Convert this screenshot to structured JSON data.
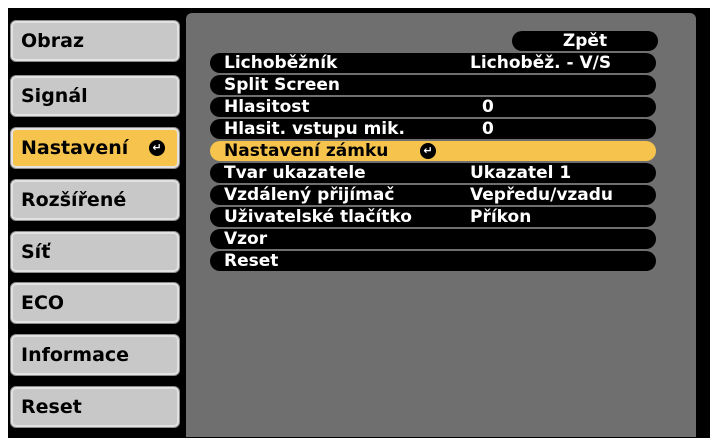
{
  "sidebar": {
    "items": [
      {
        "label": "Obraz"
      },
      {
        "label": "Signál"
      },
      {
        "label": "Nastavení"
      },
      {
        "label": "Rozšířené"
      },
      {
        "label": "Síť"
      },
      {
        "label": "ECO"
      },
      {
        "label": "Informace"
      },
      {
        "label": "Reset"
      }
    ]
  },
  "submenu": {
    "back_label": "Zpět",
    "enter_icon": "↵",
    "rows": [
      {
        "label": "Lichoběžník",
        "value": "Lichoběž. - V/S"
      },
      {
        "label": "Split Screen",
        "value": ""
      },
      {
        "label": "Hlasitost",
        "value": "0"
      },
      {
        "label": "Hlasit. vstupu mik.",
        "value": "0"
      },
      {
        "label": "Nastavení zámku",
        "value": ""
      },
      {
        "label": "Tvar ukazatele",
        "value": "Ukazatel 1"
      },
      {
        "label": "Vzdálený přijímač",
        "value": "Vepředu/vzadu"
      },
      {
        "label": "Uživatelské tlačítko",
        "value": "Příkon"
      },
      {
        "label": "Vzor",
        "value": ""
      },
      {
        "label": "Reset",
        "value": ""
      }
    ]
  }
}
